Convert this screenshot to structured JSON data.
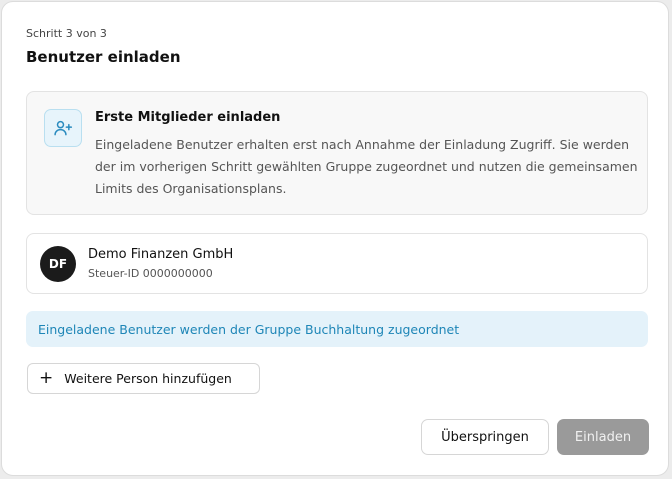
{
  "header": {
    "step": "Schritt 3 von 3",
    "title": "Benutzer einladen"
  },
  "info": {
    "icon": "user-plus-icon",
    "title": "Erste Mitglieder einladen",
    "body": "Eingeladene Benutzer erhalten erst nach Annahme der Einladung Zugriff. Sie werden der im vorherigen Schritt gewählten Gruppe zugeordnet und nutzen die gemeinsamen Limits des Organisationsplans."
  },
  "company": {
    "initials": "DF",
    "name": "Demo Finanzen GmbH",
    "tax_id": "Steuer-ID 0000000000"
  },
  "notice": {
    "text": "Eingeladene Benutzer werden der Gruppe Buchhaltung zugeordnet"
  },
  "actions": {
    "add_person_icon": "+",
    "add_person": "Weitere Person hinzufügen",
    "skip": "Überspringen",
    "invite": "Einladen"
  },
  "colors": {
    "accent": "#1e86b7",
    "notice_bg": "#e4f2fa",
    "avatar_bg": "#1b1b1b",
    "invite_disabled_bg": "#9a9a9a"
  }
}
